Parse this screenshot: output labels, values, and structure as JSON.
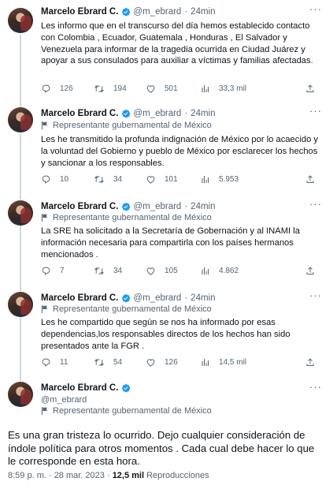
{
  "tweets": [
    {
      "name": "Marcelo Ebrard C.",
      "handle": "@m_ebrard",
      "time": "24min",
      "label": "",
      "text": "Les informo que en el transcurso del día hemos establecido contacto con Colombia , Ecuador, Guatemala , Honduras ,  El Salvador y Venezuela para informar de la tragedia ocurrida en Ciudad Juárez y apoyar a sus consulados para auxiliar a víctimas y familias afectadas.",
      "replies": "126",
      "retweets": "194",
      "likes": "501",
      "views": "33,3 mil"
    },
    {
      "name": "Marcelo Ebrard C.",
      "handle": "@m_ebrard",
      "time": "24min",
      "label": "Representante gubernamental de México",
      "text": "Les he transmitido la profunda indignación de México por lo acaecido y la voluntad del Gobierno y pueblo de México por esclarecer los hechos y sancionar a los responsables.",
      "replies": "10",
      "retweets": "34",
      "likes": "101",
      "views": "5.953"
    },
    {
      "name": "Marcelo Ebrard C.",
      "handle": "@m_ebrard",
      "time": "24min",
      "label": "Representante gubernamental de México",
      "text": "La SRE ha solicitado a la Secretaría de Gobernación y al INAMI la información necesaria para compartirla con los países hermanos mencionados .",
      "replies": "7",
      "retweets": "34",
      "likes": "105",
      "views": "4.862"
    },
    {
      "name": "Marcelo Ebrard C.",
      "handle": "@m_ebrard",
      "time": "24min",
      "label": "Representante gubernamental de México",
      "text": "Les he compartido que según se nos ha informado por esas dependencias,los responsables directos de los hechos han sido presentados ante la FGR .",
      "replies": "11",
      "retweets": "54",
      "likes": "126",
      "views": "14,5 mil"
    }
  ],
  "main_tweet": {
    "name": "Marcelo Ebrard C.",
    "handle": "@m_ebrard",
    "label": "Representante gubernamental de México",
    "text": "Es una gran tristeza lo ocurrido. Dejo cualquier consideración de índole política para otros momentos . Cada cual debe hacer lo que le corresponde en esta hora.",
    "timestamp": "8:59 p. m. · 28 mar. 2023 · ",
    "views_count": "12,5 mil",
    "views_label": " Reproducciones"
  },
  "common": {
    "separator": "·",
    "more": "···"
  },
  "colors": {
    "verified": "#1d9bf0",
    "secondary": "#536471",
    "thread_line": "#cfd9de"
  },
  "icons": [
    "verified-badge-icon",
    "government-flag-icon",
    "reply-icon",
    "retweet-icon",
    "like-icon",
    "views-icon",
    "share-icon",
    "more-options-icon"
  ]
}
